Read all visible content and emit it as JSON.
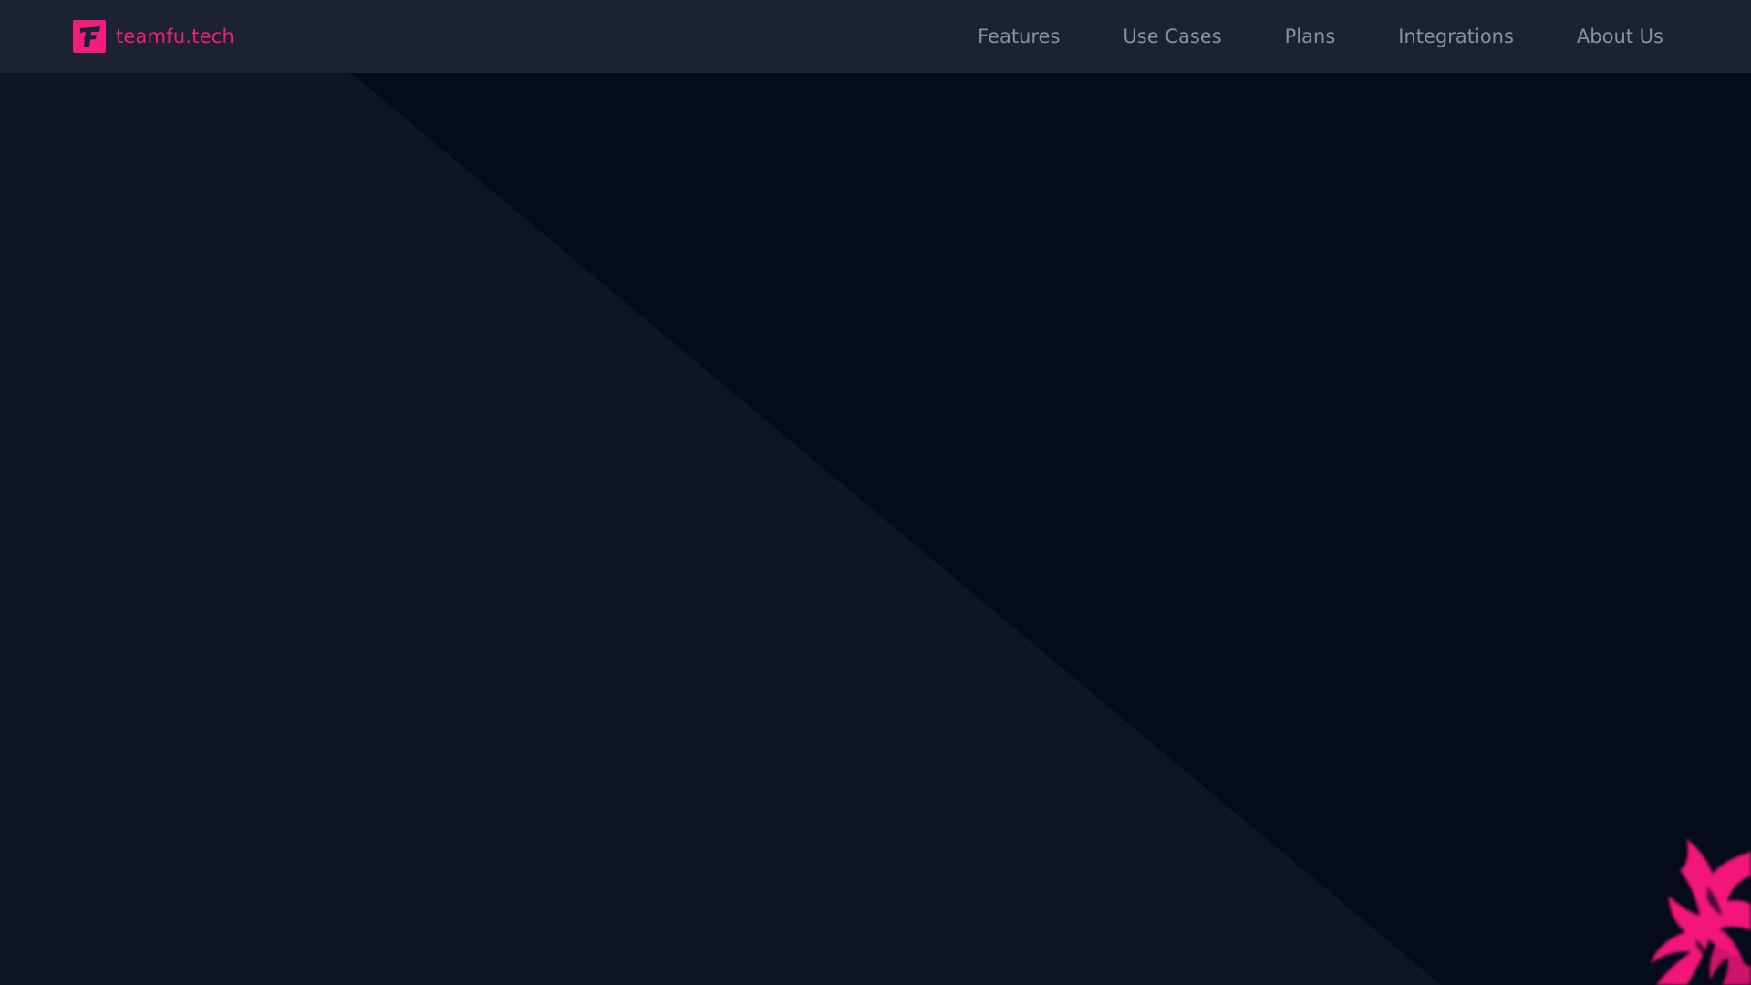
{
  "brand": {
    "name": "teamfu.tech",
    "logo_icon": "teamfu-logo-icon",
    "color": "#f21c7f"
  },
  "nav": {
    "items": [
      {
        "label": "Features"
      },
      {
        "label": "Use Cases"
      },
      {
        "label": "Plans"
      },
      {
        "label": "Integrations"
      },
      {
        "label": "About Us"
      }
    ]
  },
  "colors": {
    "topbar": "#1c2133",
    "background_dark": "#050b1a",
    "background_light": "#0e1626",
    "nav_text": "#8a8fa3",
    "accent": "#f21c7f"
  }
}
